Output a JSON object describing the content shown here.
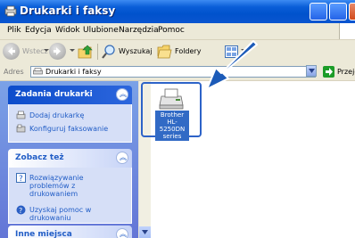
{
  "window": {
    "title": "Drukarki i faksy"
  },
  "menu": [
    "Plik",
    "Edycja",
    "Widok",
    "Ulubione",
    "Narzędzia",
    "Pomoc"
  ],
  "toolbar": {
    "back_label": "Wstecz",
    "search_label": "Wyszukaj",
    "folders_label": "Foldery"
  },
  "address": {
    "label": "Adres",
    "value": "Drukarki i faksy",
    "go_label": "Przejdź"
  },
  "tasks_panel": {
    "title": "Zadania drukarki",
    "items": [
      "Dodaj drukarkę",
      "Konfiguruj faksowanie"
    ]
  },
  "see_also_panel": {
    "title": "Zobacz też",
    "items": [
      "Rozwiązywanie problemów z drukowaniem",
      "Uzyskaj pomoc w drukowaniu"
    ]
  },
  "other_places_panel": {
    "title": "Inne miejsca"
  },
  "printer": {
    "name": "Brother HL-5250DN series"
  },
  "colors": {
    "titlebar": "#0a5ed8",
    "accent": "#215dc6",
    "highlight": "#316ac5",
    "pointer": "#1c5bb8"
  },
  "icons": [
    "printer-fax-icon",
    "back-icon",
    "forward-icon",
    "up-folder-icon",
    "search-icon",
    "folders-icon",
    "view-icon",
    "go-icon",
    "add-printer-icon",
    "fax-icon",
    "help-icon",
    "help-globe-icon",
    "printer-icon"
  ]
}
